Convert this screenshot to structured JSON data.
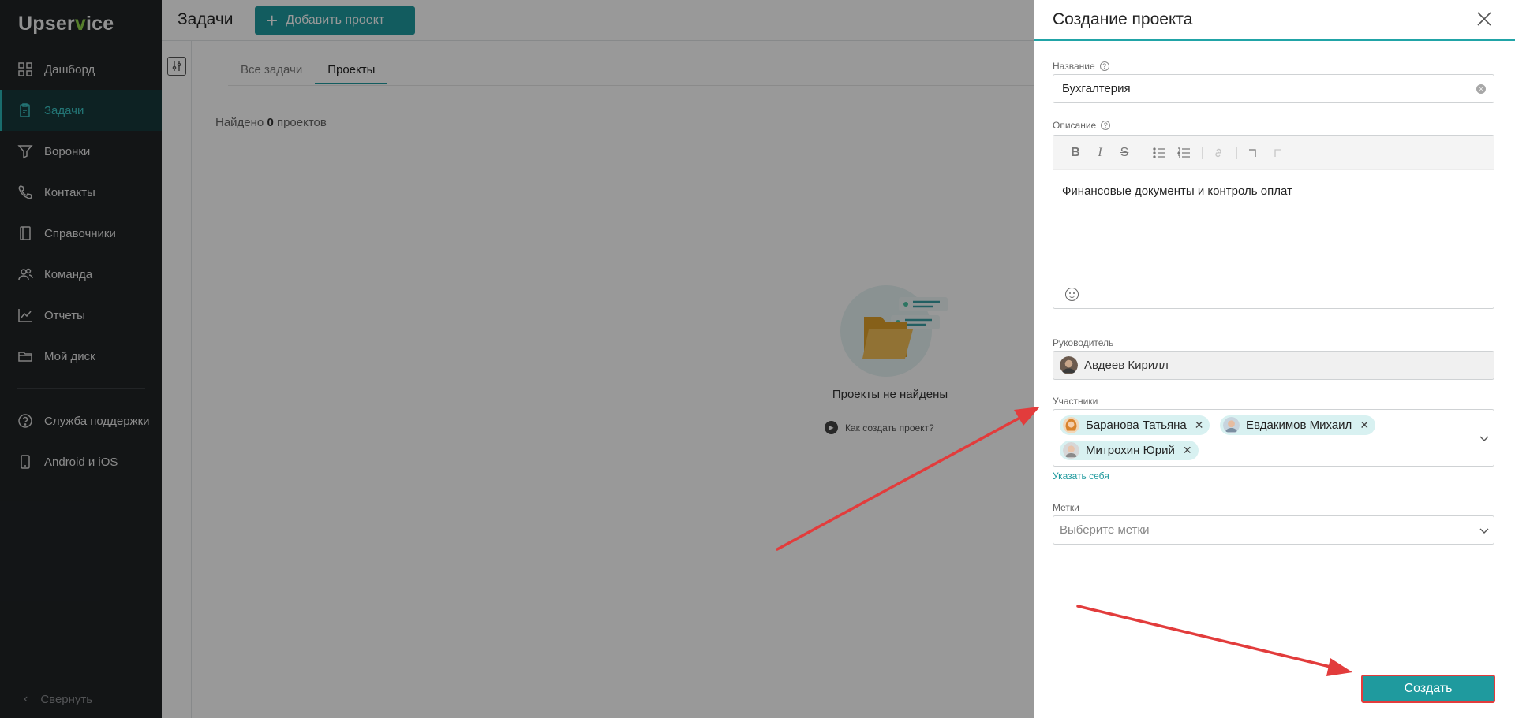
{
  "logo": {
    "text_a": "Upser",
    "text_v": "v",
    "text_b": "ice"
  },
  "sidebar": {
    "items": [
      {
        "label": "Дашборд",
        "icon": "dashboard-icon"
      },
      {
        "label": "Задачи",
        "icon": "tasks-icon",
        "active": true
      },
      {
        "label": "Воронки",
        "icon": "funnel-icon"
      },
      {
        "label": "Контакты",
        "icon": "phone-icon"
      },
      {
        "label": "Справочники",
        "icon": "book-icon"
      },
      {
        "label": "Команда",
        "icon": "team-icon"
      },
      {
        "label": "Отчеты",
        "icon": "chart-icon"
      },
      {
        "label": "Мой диск",
        "icon": "folder-icon"
      }
    ],
    "bottom_items": [
      {
        "label": "Служба поддержки",
        "icon": "help-icon"
      },
      {
        "label": "Android и iOS",
        "icon": "mobile-icon"
      }
    ],
    "collapse_label": "Свернуть"
  },
  "header": {
    "title": "Задачи",
    "add_button": "Добавить проект"
  },
  "tabs": [
    {
      "label": "Все задачи"
    },
    {
      "label": "Проекты",
      "active": true
    }
  ],
  "found": {
    "prefix": "Найдено ",
    "count": "0",
    "suffix": " проектов"
  },
  "empty": {
    "title": "Проекты не найдены",
    "howto": "Как создать проект?"
  },
  "drawer": {
    "title": "Создание проекта",
    "name_label": "Название",
    "name_value": "Бухгалтерия",
    "description_label": "Описание",
    "description_value": "Финансовые документы и контроль оплат",
    "manager_label": "Руководитель",
    "manager_value": "Авдеев Кирилл",
    "participants_label": "Участники",
    "participants": [
      {
        "name": "Баранова Татьяна"
      },
      {
        "name": "Евдакимов Михаил"
      },
      {
        "name": "Митрохин Юрий"
      }
    ],
    "self_link": "Указать себя",
    "tags_label": "Метки",
    "tags_placeholder": "Выберите метки",
    "create_button": "Создать"
  },
  "colors": {
    "accent": "#1f9a9e",
    "sidebar_bg": "#202326",
    "annotation_arrow": "#e23c3c"
  }
}
